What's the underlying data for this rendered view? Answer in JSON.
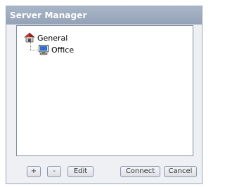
{
  "window": {
    "title": "Server Manager"
  },
  "tree": {
    "root": {
      "label": "General",
      "icon": "house-icon"
    },
    "children": [
      {
        "label": "Office",
        "icon": "computer-icon"
      }
    ]
  },
  "buttons": {
    "add": "+",
    "remove": "-",
    "edit": "Edit",
    "connect": "Connect",
    "cancel": "Cancel"
  },
  "colors": {
    "titlebar": "#a9b6c8",
    "window_bg": "#eef0f4",
    "border": "#7f8da3"
  }
}
